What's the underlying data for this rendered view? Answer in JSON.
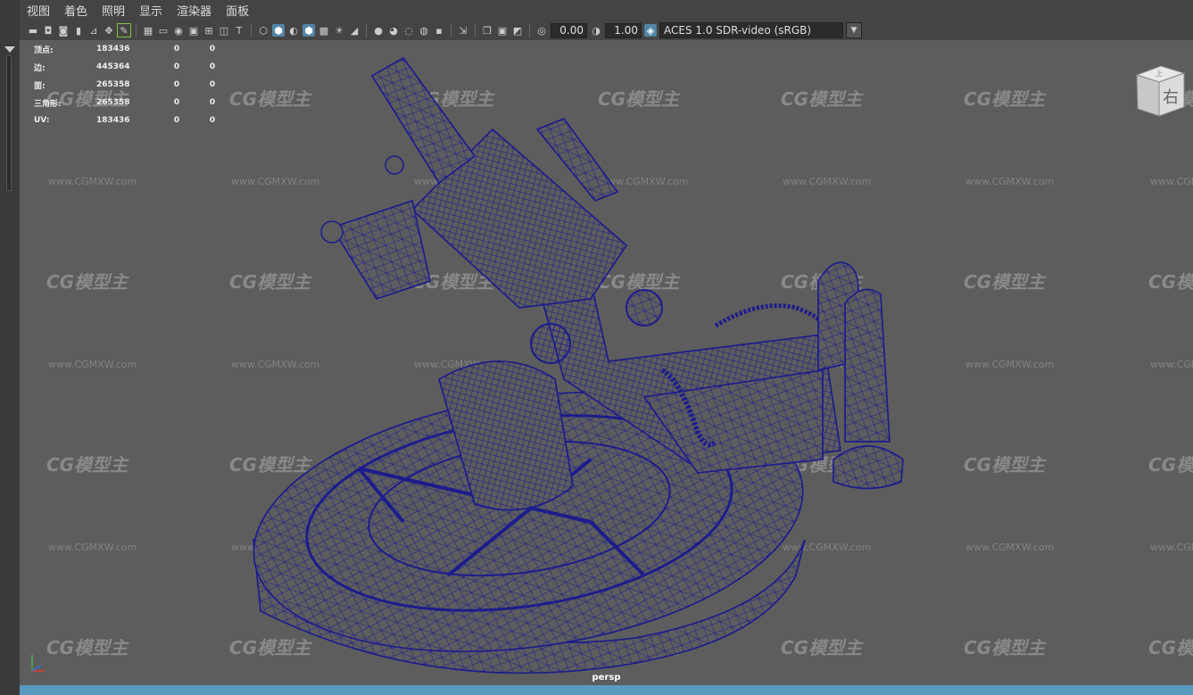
{
  "menu": [
    "视图",
    "着色",
    "照明",
    "显示",
    "渲染器",
    "面板"
  ],
  "toolbar": {
    "exposure": "0.00",
    "gamma": "1.00",
    "color_space": "ACES 1.0 SDR-video (sRGB)"
  },
  "stats": {
    "rows": [
      {
        "label": "顶点:",
        "v1": "183436",
        "v2": "0",
        "v3": "0"
      },
      {
        "label": "边:",
        "v1": "445364",
        "v2": "0",
        "v3": "0"
      },
      {
        "label": "面:",
        "v1": "265358",
        "v2": "0",
        "v3": "0"
      },
      {
        "label": "三角形:",
        "v1": "265358",
        "v2": "0",
        "v3": "0"
      },
      {
        "label": "UV:",
        "v1": "183436",
        "v2": "0",
        "v3": "0"
      }
    ]
  },
  "viewcube": {
    "face_label": "右",
    "top_label": "上"
  },
  "watermark": {
    "logo": "CG模型主",
    "url": "www.CGMXW.com"
  },
  "camera_label": "persp",
  "colors": {
    "wire": "#1c1c8c",
    "viewport": "#5d5d5d",
    "bottom": "#5a9ac0"
  }
}
